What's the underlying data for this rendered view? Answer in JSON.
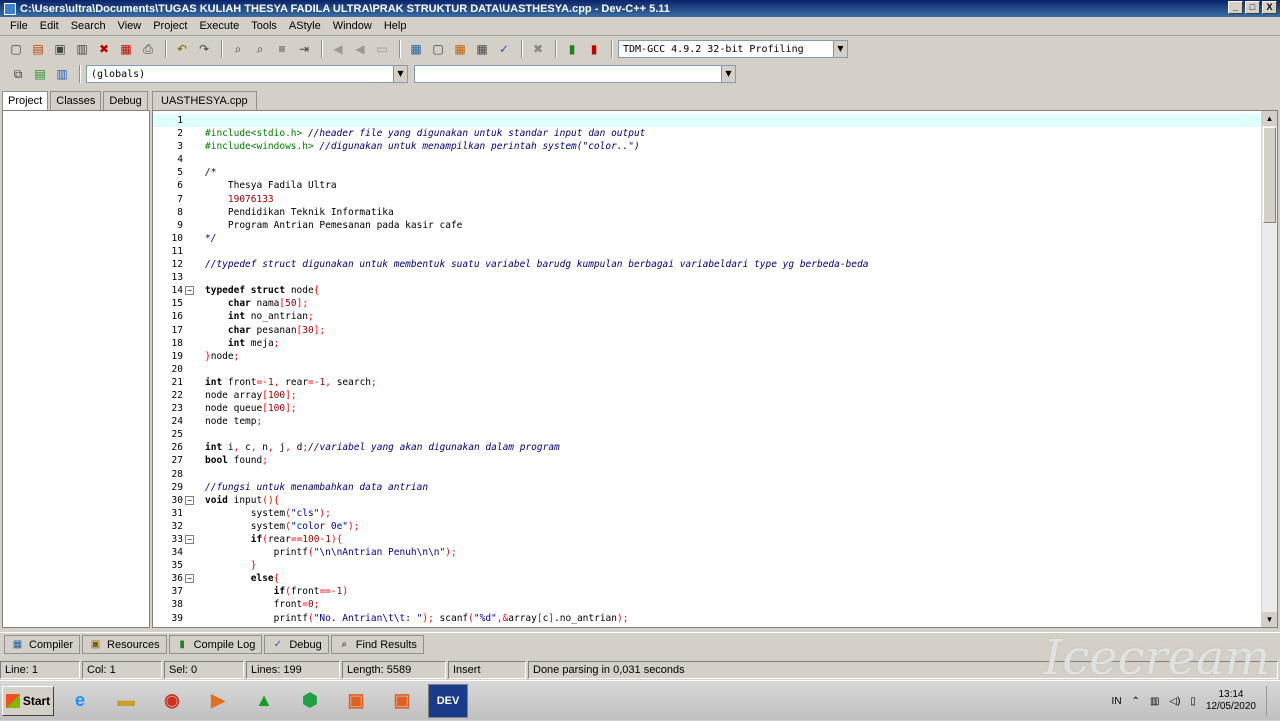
{
  "window": {
    "title": "C:\\Users\\ultra\\Documents\\TUGAS KULIAH THESYA FADILA ULTRA\\PRAK STRUKTUR DATA\\UASTHESYA.cpp - Dev-C++ 5.11",
    "minimize": "_",
    "maximize": "□",
    "close": "X"
  },
  "menu": [
    "File",
    "Edit",
    "Search",
    "View",
    "Project",
    "Execute",
    "Tools",
    "AStyle",
    "Window",
    "Help"
  ],
  "toolbar": {
    "compiler_select": "TDM-GCC 4.9.2 32-bit Profiling",
    "scope_select": "(globals)",
    "member_select": ""
  },
  "left_tabs": [
    "Project",
    "Classes",
    "Debug"
  ],
  "file_tab": "UASTHESYA.cpp",
  "code_lines": [
    {
      "n": "1",
      "t": ""
    },
    {
      "n": "2",
      "t": "#include<stdio.h> //header file yang digunakan untuk standar input dan output"
    },
    {
      "n": "3",
      "t": "#include<windows.h> //digunakan untuk menampilkan perintah system(\"color..\")"
    },
    {
      "n": "4",
      "t": ""
    },
    {
      "n": "5",
      "t": "/*"
    },
    {
      "n": "6",
      "t": "    Thesya Fadila Ultra"
    },
    {
      "n": "7",
      "t": "    19076133"
    },
    {
      "n": "8",
      "t": "    Pendidikan Teknik Informatika"
    },
    {
      "n": "9",
      "t": "    Program Antrian Pemesanan pada kasir cafe"
    },
    {
      "n": "10",
      "t": "*/"
    },
    {
      "n": "11",
      "t": ""
    },
    {
      "n": "12",
      "t": "//typedef struct digunakan untuk membentuk suatu variabel barudg kumpulan berbagai variabeldari type yg berbeda-beda"
    },
    {
      "n": "13",
      "t": ""
    },
    {
      "n": "14",
      "t": "typedef struct node{"
    },
    {
      "n": "15",
      "t": "    char nama[50];"
    },
    {
      "n": "16",
      "t": "    int no_antrian;"
    },
    {
      "n": "17",
      "t": "    char pesanan[30];"
    },
    {
      "n": "18",
      "t": "    int meja;"
    },
    {
      "n": "19",
      "t": "}node;"
    },
    {
      "n": "20",
      "t": ""
    },
    {
      "n": "21",
      "t": "int front=-1, rear=-1, search;"
    },
    {
      "n": "22",
      "t": "node array[100];"
    },
    {
      "n": "23",
      "t": "node queue[100];"
    },
    {
      "n": "24",
      "t": "node temp;"
    },
    {
      "n": "25",
      "t": ""
    },
    {
      "n": "26",
      "t": "int i, c, n, j, d;//variabel yang akan digunakan dalam program"
    },
    {
      "n": "27",
      "t": "bool found;"
    },
    {
      "n": "28",
      "t": ""
    },
    {
      "n": "29",
      "t": "//fungsi untuk menambahkan data antrian"
    },
    {
      "n": "30",
      "t": "void input(){"
    },
    {
      "n": "31",
      "t": "        system(\"cls\");"
    },
    {
      "n": "32",
      "t": "        system(\"color 0e\");"
    },
    {
      "n": "33",
      "t": "        if(rear==100-1){"
    },
    {
      "n": "34",
      "t": "            printf(\"\\n\\nAntrian Penuh\\n\\n\");"
    },
    {
      "n": "35",
      "t": "        }"
    },
    {
      "n": "36",
      "t": "        else{"
    },
    {
      "n": "37",
      "t": "            if(front==-1)"
    },
    {
      "n": "38",
      "t": "            front=0;"
    },
    {
      "n": "39",
      "t": "            printf(\"No. Antrian\\t\\t: \"); scanf(\"%d\",&array[c].no_antrian);"
    }
  ],
  "bottom_tabs": [
    "Compiler",
    "Resources",
    "Compile Log",
    "Debug",
    "Find Results"
  ],
  "status": {
    "line": "Line:   1",
    "col": "Col:   1",
    "sel": "Sel:   0",
    "lines": "Lines:   199",
    "length": "Length:   5589",
    "mode": "Insert",
    "message": "Done parsing in 0,031 seconds"
  },
  "taskbar": {
    "start": "Start",
    "lang": "IN",
    "time": "13:14",
    "date": "12/05/2020"
  },
  "watermark": "Icecream"
}
